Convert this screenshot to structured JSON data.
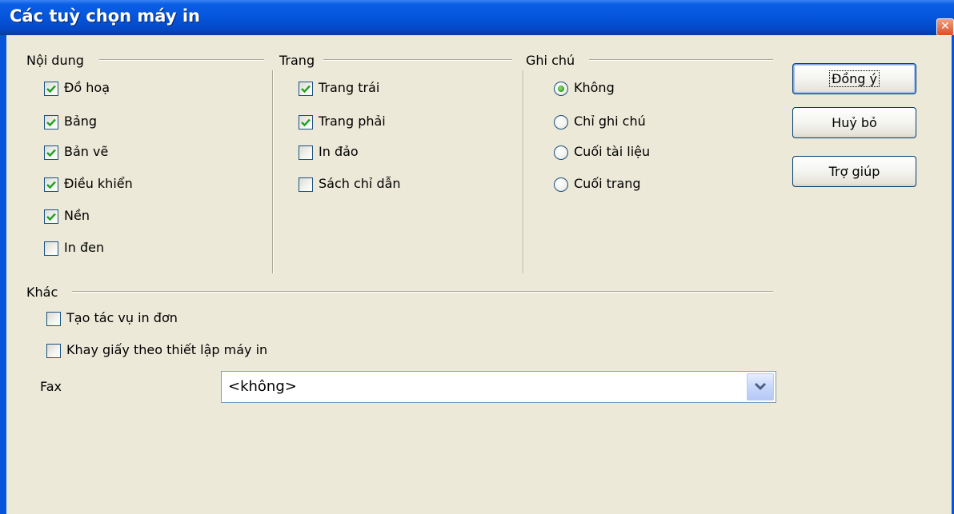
{
  "window": {
    "title": "Các tuỳ chọn máy in",
    "close_glyph": "✕"
  },
  "groups": {
    "content": {
      "label": "Nội dung",
      "items": [
        {
          "label": "Đồ hoạ",
          "checked": true
        },
        {
          "label": "Bảng",
          "checked": true
        },
        {
          "label": "Bản vẽ",
          "checked": true
        },
        {
          "label": "Điều khiển",
          "checked": true
        },
        {
          "label": "Nền",
          "checked": true
        },
        {
          "label": "In đen",
          "checked": false
        }
      ]
    },
    "pages": {
      "label": "Trang",
      "items": [
        {
          "label": "Trang trái",
          "checked": true
        },
        {
          "label": "Trang phải",
          "checked": true
        },
        {
          "label": "In đảo",
          "checked": false
        },
        {
          "label": "Sách chỉ dẫn",
          "checked": false
        }
      ]
    },
    "notes": {
      "label": "Ghi chú",
      "options": [
        {
          "label": "Không",
          "selected": true
        },
        {
          "label": "Chỉ ghi chú",
          "selected": false
        },
        {
          "label": "Cuối tài liệu",
          "selected": false
        },
        {
          "label": "Cuối trang",
          "selected": false
        }
      ]
    },
    "other": {
      "label": "Khác",
      "items": [
        {
          "label": "Tạo tác vụ in đơn",
          "checked": false
        },
        {
          "label": "Khay giấy theo thiết lập máy in",
          "checked": false
        }
      ],
      "fax_label": "Fax",
      "fax_value": "<không>"
    }
  },
  "buttons": {
    "ok": "Đồng ý",
    "cancel": "Huỷ bỏ",
    "help": "Trợ giúp"
  },
  "colors": {
    "titlebar": "#0554dc",
    "dialog_bg": "#ece9d8",
    "check_green": "#21a121"
  }
}
